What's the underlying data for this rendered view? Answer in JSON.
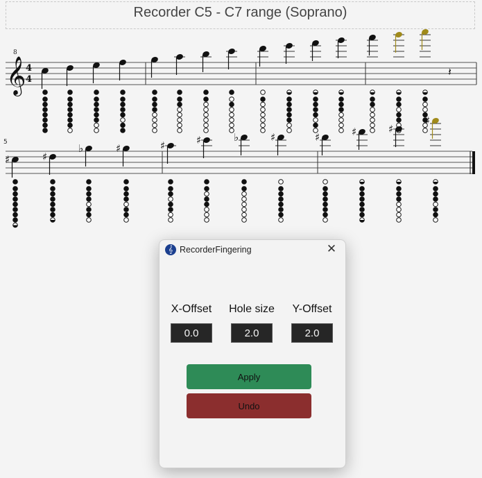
{
  "score": {
    "title": "Recorder C5 - C7 range (Soprano)",
    "octave_marking": "8",
    "time_signature": {
      "top": "4",
      "bottom": "4"
    },
    "measure_number": "5",
    "highlight_color": "#a08a1a",
    "system1": [
      {
        "pitch": "C5",
        "accidental": "",
        "holes": [
          1,
          1,
          1,
          1,
          1,
          1,
          1,
          1
        ],
        "highlight": false
      },
      {
        "pitch": "D5",
        "accidental": "",
        "holes": [
          1,
          1,
          1,
          1,
          1,
          1,
          1,
          0
        ],
        "highlight": false
      },
      {
        "pitch": "E5",
        "accidental": "",
        "holes": [
          1,
          1,
          1,
          1,
          1,
          1,
          0,
          0
        ],
        "highlight": false
      },
      {
        "pitch": "F5",
        "accidental": "",
        "holes": [
          1,
          1,
          1,
          1,
          1,
          0,
          1,
          1
        ],
        "highlight": false
      },
      {
        "pitch": "G5",
        "accidental": "",
        "holes": [
          1,
          1,
          1,
          1,
          0,
          0,
          0,
          0
        ],
        "highlight": false
      },
      {
        "pitch": "A5",
        "accidental": "",
        "holes": [
          1,
          1,
          1,
          0,
          0,
          0,
          0,
          0
        ],
        "highlight": false
      },
      {
        "pitch": "B5",
        "accidental": "",
        "holes": [
          1,
          1,
          0,
          0,
          0,
          0,
          0,
          0
        ],
        "highlight": false
      },
      {
        "pitch": "C6",
        "accidental": "",
        "holes": [
          1,
          0,
          1,
          0,
          0,
          0,
          0,
          0
        ],
        "highlight": false
      },
      {
        "pitch": "D6",
        "accidental": "",
        "holes": [
          0,
          1,
          0,
          0,
          0,
          0,
          0,
          0
        ],
        "highlight": false
      },
      {
        "pitch": "E6",
        "accidental": "",
        "holes": [
          2,
          1,
          1,
          1,
          1,
          1,
          0,
          0
        ],
        "highlight": false
      },
      {
        "pitch": "F6",
        "accidental": "",
        "holes": [
          2,
          1,
          1,
          1,
          1,
          0,
          1,
          0
        ],
        "highlight": false
      },
      {
        "pitch": "G6",
        "accidental": "",
        "holes": [
          2,
          1,
          1,
          1,
          0,
          0,
          0,
          0
        ],
        "highlight": false
      },
      {
        "pitch": "A6",
        "accidental": "",
        "holes": [
          2,
          1,
          1,
          0,
          0,
          0,
          0,
          0
        ],
        "highlight": false
      },
      {
        "pitch": "B6",
        "accidental": "",
        "holes": [
          2,
          1,
          1,
          0,
          1,
          1,
          0,
          0
        ],
        "highlight": true
      },
      {
        "pitch": "C7",
        "accidental": "",
        "holes": [
          2,
          1,
          0,
          0,
          1,
          1,
          0,
          0
        ],
        "highlight": true
      }
    ],
    "rest_label": "rest",
    "system2": [
      {
        "pitch": "C#5",
        "accidental": "sharp",
        "holes": [
          1,
          1,
          1,
          1,
          1,
          1,
          1,
          1,
          2
        ],
        "highlight": false
      },
      {
        "pitch": "D#5",
        "accidental": "sharp",
        "holes": [
          1,
          1,
          1,
          1,
          1,
          1,
          1,
          2
        ],
        "highlight": false
      },
      {
        "pitch": "Gb5",
        "accidental": "flat",
        "holes": [
          1,
          1,
          1,
          1,
          0,
          1,
          1,
          0
        ],
        "highlight": false
      },
      {
        "pitch": "G#5",
        "accidental": "sharp",
        "holes": [
          1,
          1,
          1,
          1,
          0,
          1,
          1,
          0
        ],
        "highlight": false
      },
      {
        "pitch": "A#5",
        "accidental": "sharp",
        "holes": [
          1,
          1,
          1,
          0,
          1,
          1,
          0,
          0
        ],
        "highlight": false
      },
      {
        "pitch": "C#6",
        "accidental": "sharp",
        "holes": [
          1,
          1,
          0,
          1,
          1,
          0,
          0,
          0
        ],
        "highlight": false
      },
      {
        "pitch": "Db6",
        "accidental": "flat",
        "holes": [
          1,
          1,
          0,
          0,
          0,
          0,
          0,
          0
        ],
        "highlight": false
      },
      {
        "pitch": "D#6",
        "accidental": "sharp",
        "holes": [
          0,
          1,
          1,
          1,
          1,
          1,
          1,
          0
        ],
        "highlight": false
      },
      {
        "pitch": "D#6",
        "accidental": "sharp",
        "holes": [
          0,
          1,
          1,
          1,
          1,
          1,
          1,
          0
        ],
        "highlight": false
      },
      {
        "pitch": "F#6",
        "accidental": "sharp",
        "holes": [
          2,
          1,
          1,
          1,
          1,
          1,
          1,
          2
        ],
        "highlight": false
      },
      {
        "pitch": "G#6",
        "accidental": "sharp",
        "holes": [
          2,
          1,
          1,
          1,
          0,
          0,
          0,
          0
        ],
        "highlight": false
      },
      {
        "pitch": "C#7",
        "accidental": "sharp",
        "holes": [
          2,
          1,
          1,
          1,
          0,
          1,
          1,
          0
        ],
        "highlight": true
      }
    ]
  },
  "dialog": {
    "icon": "musescore-logo-icon",
    "title": "RecorderFingering",
    "close_icon": "close-icon",
    "fields": {
      "x_offset": {
        "label": "X-Offset",
        "value": "0.0"
      },
      "hole_size": {
        "label": "Hole size",
        "value": "2.0"
      },
      "y_offset": {
        "label": "Y-Offset",
        "value": "2.0"
      }
    },
    "apply_label": "Apply",
    "undo_label": "Undo",
    "apply_color": "#2e8b57",
    "undo_color": "#8b2e2e"
  }
}
